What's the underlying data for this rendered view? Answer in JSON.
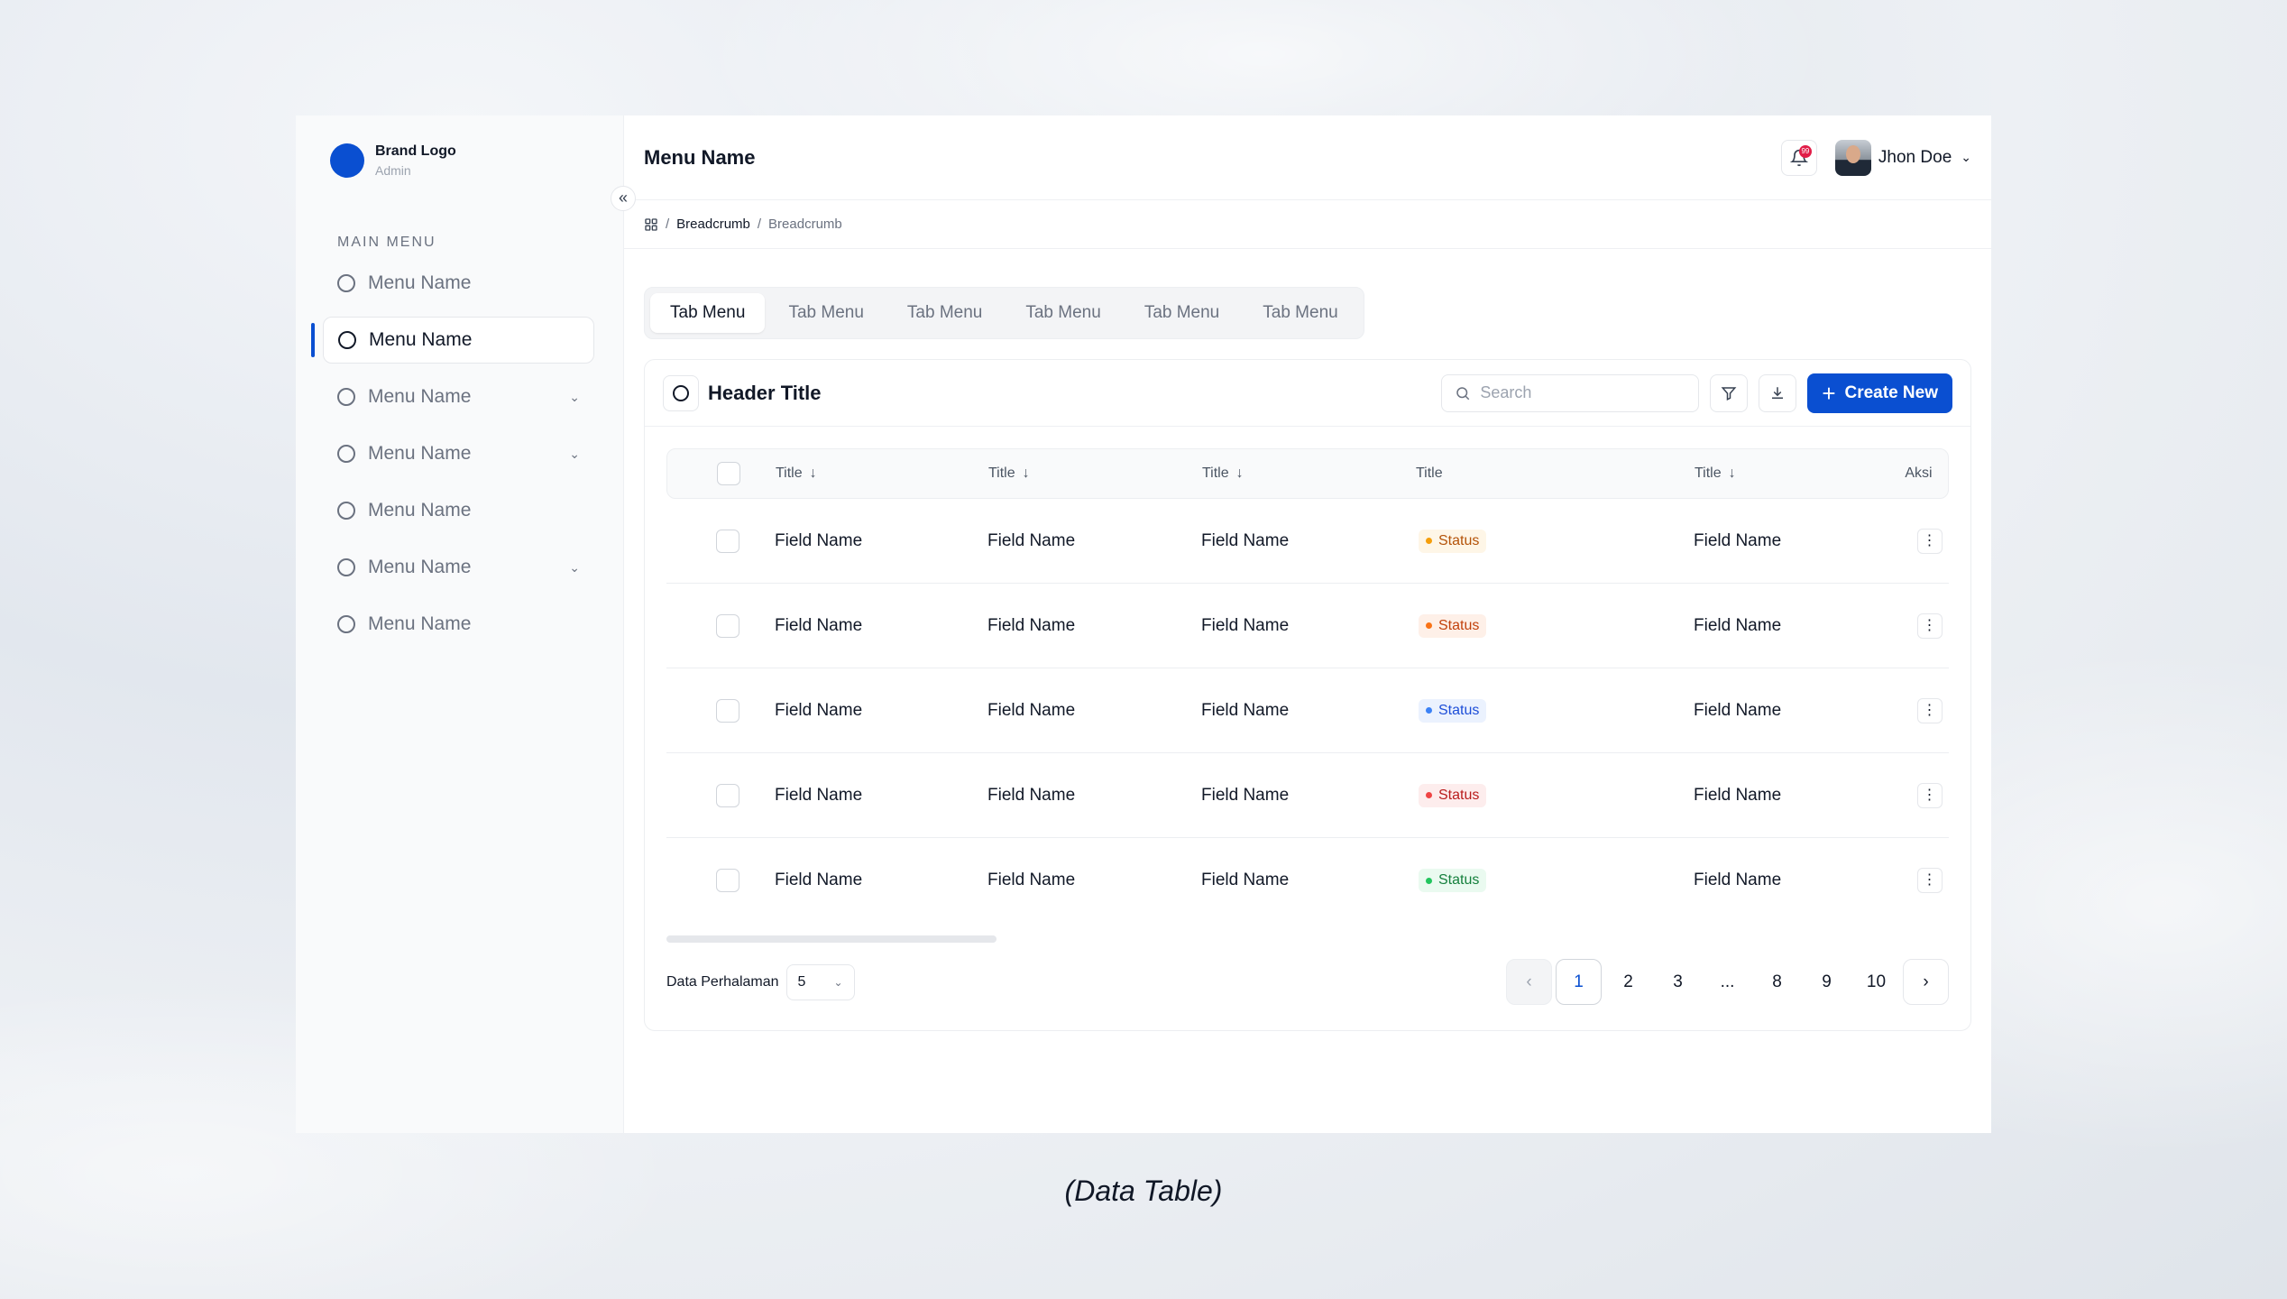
{
  "brand": {
    "name": "Brand Logo",
    "role": "Admin",
    "color": "#0a4fd1"
  },
  "sidebar": {
    "section_label": "MAIN MENU",
    "items": [
      {
        "label": "Menu Name",
        "active": false,
        "has_submenu": false
      },
      {
        "label": "Menu Name",
        "active": true,
        "has_submenu": false
      },
      {
        "label": "Menu Name",
        "active": false,
        "has_submenu": true
      },
      {
        "label": "Menu Name",
        "active": false,
        "has_submenu": true
      },
      {
        "label": "Menu Name",
        "active": false,
        "has_submenu": false
      },
      {
        "label": "Menu Name",
        "active": false,
        "has_submenu": true
      },
      {
        "label": "Menu Name",
        "active": false,
        "has_submenu": false
      }
    ]
  },
  "topbar": {
    "title": "Menu Name",
    "notification_count": "99",
    "user_name": "Jhon Doe"
  },
  "breadcrumb": [
    "Breadcrumb",
    "Breadcrumb"
  ],
  "tabs": [
    {
      "label": "Tab Menu",
      "active": true
    },
    {
      "label": "Tab Menu",
      "active": false
    },
    {
      "label": "Tab Menu",
      "active": false
    },
    {
      "label": "Tab Menu",
      "active": false
    },
    {
      "label": "Tab Menu",
      "active": false
    },
    {
      "label": "Tab Menu",
      "active": false
    }
  ],
  "card": {
    "title": "Header Title",
    "search_placeholder": "Search",
    "create_label": "Create New"
  },
  "table": {
    "columns": [
      {
        "label": "Title",
        "sortable": true
      },
      {
        "label": "Title",
        "sortable": true
      },
      {
        "label": "Title",
        "sortable": true
      },
      {
        "label": "Title",
        "sortable": false
      },
      {
        "label": "Title",
        "sortable": true
      },
      {
        "label": "Aksi",
        "sortable": false
      }
    ],
    "rows": [
      {
        "cells": [
          "Field Name",
          "Field Name",
          "Field Name",
          "Field Name"
        ],
        "status": "Status",
        "status_color": "#f59e0b",
        "status_bg": "#fef6e7",
        "status_text": "#b45309"
      },
      {
        "cells": [
          "Field Name",
          "Field Name",
          "Field Name",
          "Field Name"
        ],
        "status": "Status",
        "status_color": "#f97316",
        "status_bg": "#fef0e8",
        "status_text": "#c2410c"
      },
      {
        "cells": [
          "Field Name",
          "Field Name",
          "Field Name",
          "Field Name"
        ],
        "status": "Status",
        "status_color": "#3b82f6",
        "status_bg": "#ebf2fe",
        "status_text": "#1d4ed8"
      },
      {
        "cells": [
          "Field Name",
          "Field Name",
          "Field Name",
          "Field Name"
        ],
        "status": "Status",
        "status_color": "#ef4444",
        "status_bg": "#fdeded",
        "status_text": "#b91c1c"
      },
      {
        "cells": [
          "Field Name",
          "Field Name",
          "Field Name",
          "Field Name"
        ],
        "status": "Status",
        "status_color": "#22c55e",
        "status_bg": "#eafaf0",
        "status_text": "#15803d"
      }
    ]
  },
  "footer": {
    "per_page_label": "Data Perhalaman",
    "per_page_value": "5",
    "pages": [
      "1",
      "2",
      "3",
      "...",
      "8",
      "9",
      "10"
    ],
    "current_page": "1"
  },
  "caption": "(Data Table)"
}
